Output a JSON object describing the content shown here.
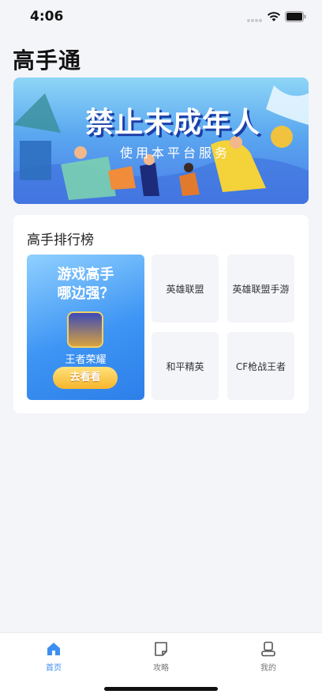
{
  "status": {
    "time": "4:06"
  },
  "page": {
    "title": "高手通"
  },
  "banner": {
    "headline": "禁止未成年人",
    "subtitle": "使用本平台服务"
  },
  "ranking": {
    "title": "高手排行榜",
    "promo": {
      "heading_line1": "游戏高手",
      "heading_line2": "哪边强？",
      "game_name": "王者荣耀",
      "button": "去看看"
    },
    "games": [
      {
        "label": "英雄联盟"
      },
      {
        "label": "英雄联盟手游"
      },
      {
        "label": "和平精英"
      },
      {
        "label": "CF枪战王者"
      }
    ]
  },
  "tabs": [
    {
      "label": "首页",
      "icon": "home-icon",
      "active": true
    },
    {
      "label": "攻略",
      "icon": "guide-icon",
      "active": false
    },
    {
      "label": "我的",
      "icon": "profile-icon",
      "active": false
    }
  ],
  "colors": {
    "accent": "#3d8ef0",
    "background": "#f4f5f9",
    "promo_button": "#f7b52c"
  }
}
